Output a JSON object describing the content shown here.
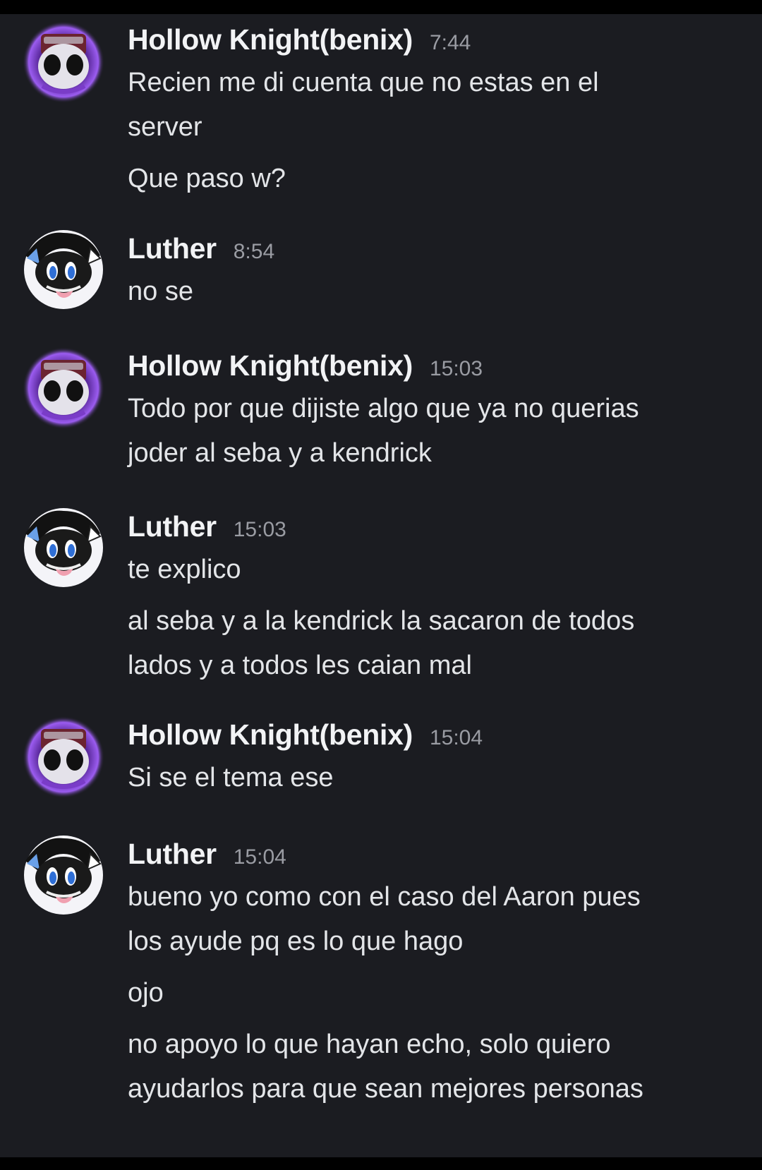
{
  "chat": {
    "messages": [
      {
        "author": "Hollow Knight(benix)",
        "time": "7:44",
        "avatar_icon": "hollow-knight-avatar-icon",
        "lines": [
          {
            "text": "Recien me di cuenta que no estas en el"
          },
          {
            "text": "server"
          },
          {
            "text": "Que paso w?"
          }
        ]
      },
      {
        "author": "Luther",
        "time": "8:54",
        "avatar_icon": "luther-avatar-icon",
        "lines": [
          {
            "text": "no se"
          }
        ]
      },
      {
        "author": "Hollow Knight(benix)",
        "time": "15:03",
        "avatar_icon": "hollow-knight-avatar-icon",
        "lines": [
          {
            "text": "Todo por que dijiste algo que ya no querias"
          },
          {
            "text": "joder al seba y a kendrick"
          }
        ]
      },
      {
        "author": "Luther",
        "time": "15:03",
        "avatar_icon": "luther-avatar-icon",
        "lines": [
          {
            "text": "te explico"
          },
          {
            "text": "al seba y a la kendrick la sacaron de todos"
          },
          {
            "text": "lados y a todos les caian mal"
          }
        ]
      },
      {
        "author": "Hollow Knight(benix)",
        "time": "15:04",
        "avatar_icon": "hollow-knight-avatar-icon",
        "lines": [
          {
            "text": "Si se el tema ese"
          }
        ]
      },
      {
        "author": "Luther",
        "time": "15:04",
        "avatar_icon": "luther-avatar-icon",
        "lines": [
          {
            "text": "bueno yo como con el caso del Aaron pues"
          },
          {
            "text": "los ayude pq es lo que hago"
          },
          {
            "text": "ojo"
          },
          {
            "text": "no apoyo lo que hayan echo, solo quiero"
          },
          {
            "text": "ayudarlos para que sean mejores personas"
          }
        ]
      }
    ]
  },
  "colors": {
    "background": "#1b1c21",
    "username": "#f2f3f5",
    "timestamp": "#9a9ca3",
    "message_text": "#e3e5e8"
  }
}
